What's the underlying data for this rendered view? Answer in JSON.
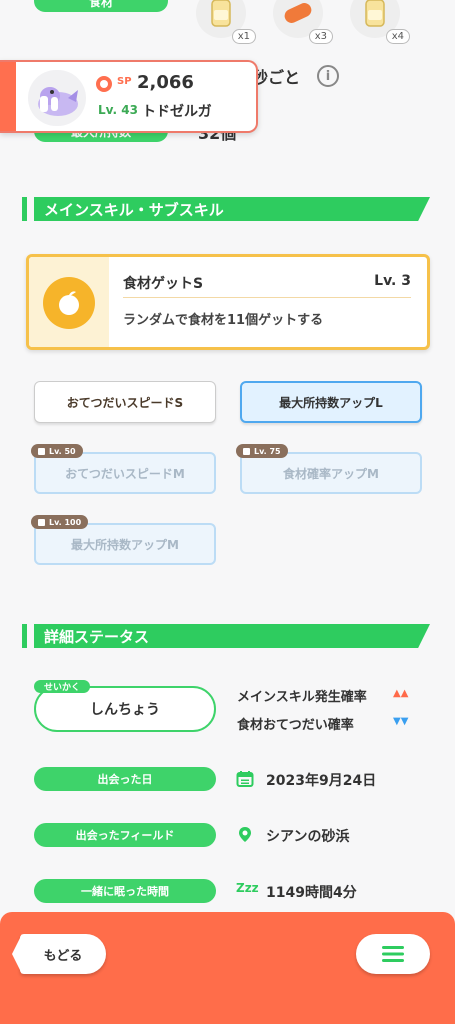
{
  "top": {
    "ingredient_label": "食材",
    "ingredients": [
      {
        "icon": "honey-jar-icon",
        "count": "x1"
      },
      {
        "icon": "sausage-icon",
        "count": "x3"
      },
      {
        "icon": "honey-jar-icon",
        "count": "x4"
      }
    ],
    "help_interval_partial": "秒ごと",
    "max_carry_label": "最大所持数",
    "max_carry_value": "32個"
  },
  "pokemon": {
    "sp_label": "SP",
    "sp_value": "2,066",
    "level": "Lv. 43",
    "name": "トドゼルガ"
  },
  "skills_section": {
    "title": "メインスキル・サブスキル",
    "main_skill": {
      "name": "食材ゲットS",
      "level": "Lv. 3",
      "description": "ランダムで食材を11個ゲットする",
      "icon": "apple-icon"
    },
    "sub_skills": [
      {
        "label": "おてつだいスピードS",
        "state": "white"
      },
      {
        "label": "最大所持数アップL",
        "state": "blue"
      },
      {
        "label": "おてつだいスピードM",
        "state": "locked",
        "unlock": "Lv. 50"
      },
      {
        "label": "食材確率アップM",
        "state": "locked",
        "unlock": "Lv. 75"
      },
      {
        "label": "最大所持数アップM",
        "state": "locked",
        "unlock": "Lv. 100"
      }
    ]
  },
  "detail_section": {
    "title": "詳細ステータス",
    "nature_tag": "せいかく",
    "nature": "しんちょう",
    "effect_up": "メインスキル発生確率",
    "effect_up_arrows": "▲▲",
    "effect_down": "食材おてつだい確率",
    "effect_down_arrows": "▼▼",
    "rows": [
      {
        "label": "出会った日",
        "icon": "calendar-icon",
        "value": "2023年9月24日"
      },
      {
        "label": "出会ったフィールド",
        "icon": "location-pin-icon",
        "value": "シアンの砂浜"
      },
      {
        "label": "一緒に眠った時間",
        "icon": "sleep-zzz-icon",
        "icon_text": "Zzz",
        "value": "1149時間4分"
      }
    ]
  },
  "footer": {
    "back_label": "もどる",
    "menu_icon": "hamburger-menu-icon"
  },
  "colors": {
    "green": "#3ed36a",
    "orange": "#ff6d4a",
    "gold": "#f6c14a",
    "blue": "#4fa8ef",
    "up_arrow": "#ff6a4a",
    "down_arrow": "#3a9ff0"
  }
}
